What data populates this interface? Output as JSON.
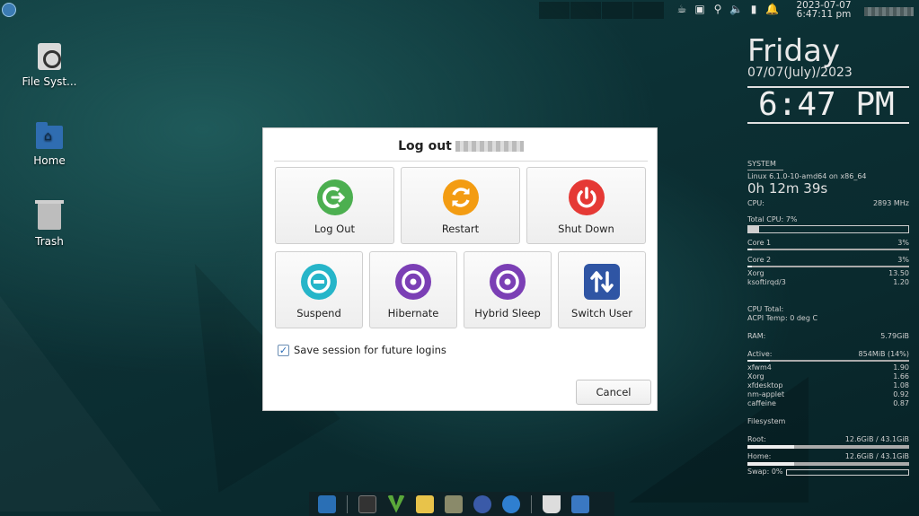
{
  "top_panel": {
    "datetime_line1": "2023-07-07",
    "datetime_line2": "6:47:11 pm"
  },
  "desktop_icons": [
    {
      "label": "File Syst..."
    },
    {
      "label": "Home"
    },
    {
      "label": "Trash"
    }
  ],
  "conky": {
    "day": "Friday",
    "date": "07/07(July)/2023",
    "time": "6:47 PM",
    "system_label": "SYSTEM",
    "kernel": "Linux 6.1.0-10-amd64 on x86_64",
    "uptime": "0h 12m 39s",
    "cpu_label": "CPU:",
    "cpu_freq": "2893 MHz",
    "total_cpu": "Total CPU: 7%",
    "total_cpu_pct": 7,
    "cores": [
      {
        "label": "Core 1",
        "value": "3%",
        "pct": 3
      },
      {
        "label": "Core 2",
        "value": "3%",
        "pct": 3
      }
    ],
    "cpu_procs": [
      {
        "name": "Xorg",
        "value": "13.50"
      },
      {
        "name": "ksoftirqd/3",
        "value": "1.20"
      }
    ],
    "cpu_total_label": "CPU Total:",
    "acpi_temp": "ACPI Temp: 0 deg C",
    "ram_label": "RAM:",
    "ram_value": "5.79GiB",
    "active_label": "Active:",
    "active_value": "854MiB (14%)",
    "active_pct": 14,
    "mem_procs": [
      {
        "name": "xfwm4",
        "value": "1.90"
      },
      {
        "name": "Xorg",
        "value": "1.66"
      },
      {
        "name": "xfdesktop",
        "value": "1.08"
      },
      {
        "name": "nm-applet",
        "value": "0.92"
      },
      {
        "name": "caffeine",
        "value": "0.87"
      }
    ],
    "filesystem_label": "Filesystem",
    "root_label": "Root:",
    "root_value": "12.6GiB / 43.1GiB",
    "root_pct": 29,
    "home_label": "Home:",
    "home_value": "12.6GiB / 43.1GiB",
    "home_pct": 29,
    "swap_label": "Swap: 0%",
    "swap_pct": 0
  },
  "dialog": {
    "title": "Log out",
    "buttons_row1": [
      {
        "label": "Log Out",
        "icon": "logout-icon",
        "color": "#4caf50"
      },
      {
        "label": "Restart",
        "icon": "restart-icon",
        "color": "#f39c12"
      },
      {
        "label": "Shut Down",
        "icon": "power-icon",
        "color": "#e53935"
      }
    ],
    "buttons_row2": [
      {
        "label": "Suspend",
        "icon": "suspend-icon",
        "color": "#26b5c9"
      },
      {
        "label": "Hibernate",
        "icon": "hibernate-icon",
        "color": "#7b3fb5"
      },
      {
        "label": "Hybrid Sleep",
        "icon": "hybrid-sleep-icon",
        "color": "#7b3fb5"
      },
      {
        "label": "Switch User",
        "icon": "switch-user-icon",
        "color": "#2f55a4"
      }
    ],
    "save_session_label": "Save session for future logins",
    "save_session_checked": true,
    "cancel_label": "Cancel"
  }
}
